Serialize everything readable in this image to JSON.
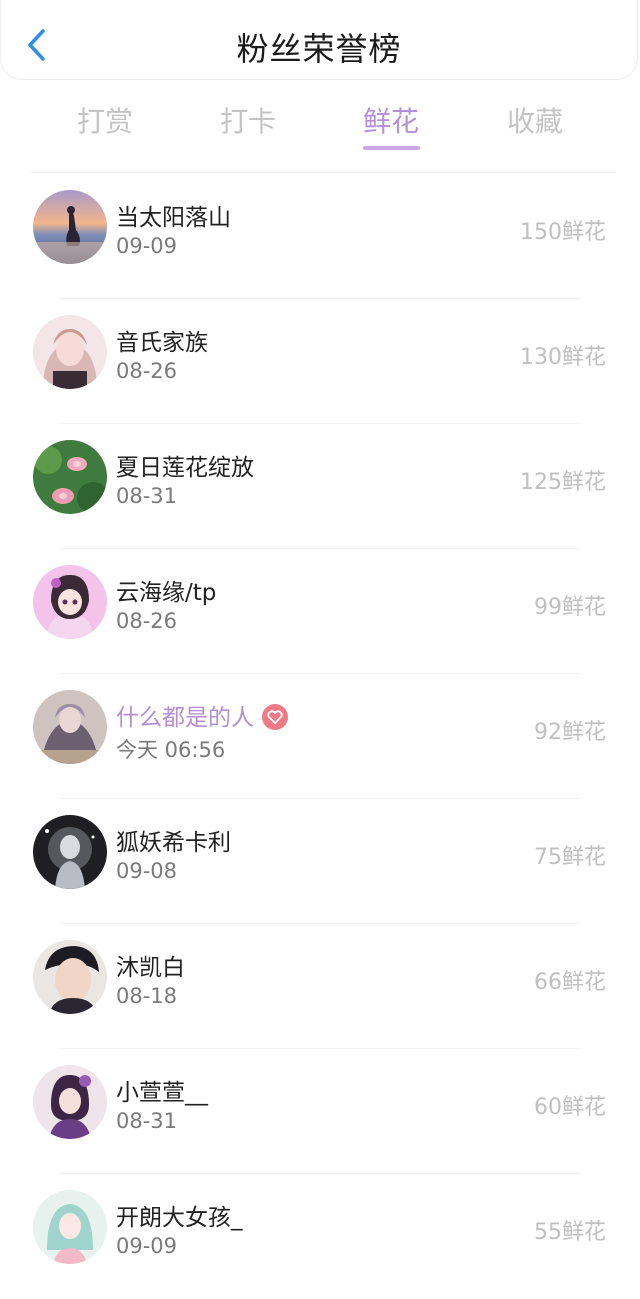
{
  "header": {
    "title": "粉丝荣誉榜",
    "back_icon": "chevron-left-icon",
    "accent": "#2f8fe8"
  },
  "tabs": [
    {
      "label": "打赏",
      "active": false
    },
    {
      "label": "打卡",
      "active": false
    },
    {
      "label": "鲜花",
      "active": true
    },
    {
      "label": "收藏",
      "active": false
    }
  ],
  "colors": {
    "active_tab": "#b48ed6",
    "inactive_tab": "#c4c4c4",
    "highlight_name": "#b48ed6",
    "badge": "#f07a86"
  },
  "fans": [
    {
      "name": "当太阳落山",
      "date": "09-09",
      "score": "150鲜花",
      "highlight": false,
      "avatar_icon": "sunset-beach-avatar"
    },
    {
      "name": "音氏家族",
      "date": "08-26",
      "score": "130鲜花",
      "highlight": false,
      "avatar_icon": "anime-girl-avatar"
    },
    {
      "name": "夏日莲花绽放",
      "date": "08-31",
      "score": "125鲜花",
      "highlight": false,
      "avatar_icon": "lotus-flower-avatar"
    },
    {
      "name": "云海缘/tp",
      "date": "08-26",
      "score": "99鲜花",
      "highlight": false,
      "avatar_icon": "chibi-girl-avatar"
    },
    {
      "name": "什么都是的人",
      "date": "今天 06:56",
      "score": "92鲜花",
      "highlight": true,
      "badge_icon": "heart-badge-icon",
      "avatar_icon": "anime-character-avatar"
    },
    {
      "name": "狐妖希卡利",
      "date": "09-08",
      "score": "75鲜花",
      "highlight": false,
      "avatar_icon": "fox-spirit-avatar"
    },
    {
      "name": "沐凯白",
      "date": "08-18",
      "score": "66鲜花",
      "highlight": false,
      "avatar_icon": "boy-portrait-avatar"
    },
    {
      "name": "小萱萱__",
      "date": "08-31",
      "score": "60鲜花",
      "highlight": false,
      "avatar_icon": "purple-girl-avatar"
    },
    {
      "name": "开朗大女孩_",
      "date": "09-09",
      "score": "55鲜花",
      "highlight": false,
      "avatar_icon": "teal-girl-avatar"
    }
  ]
}
